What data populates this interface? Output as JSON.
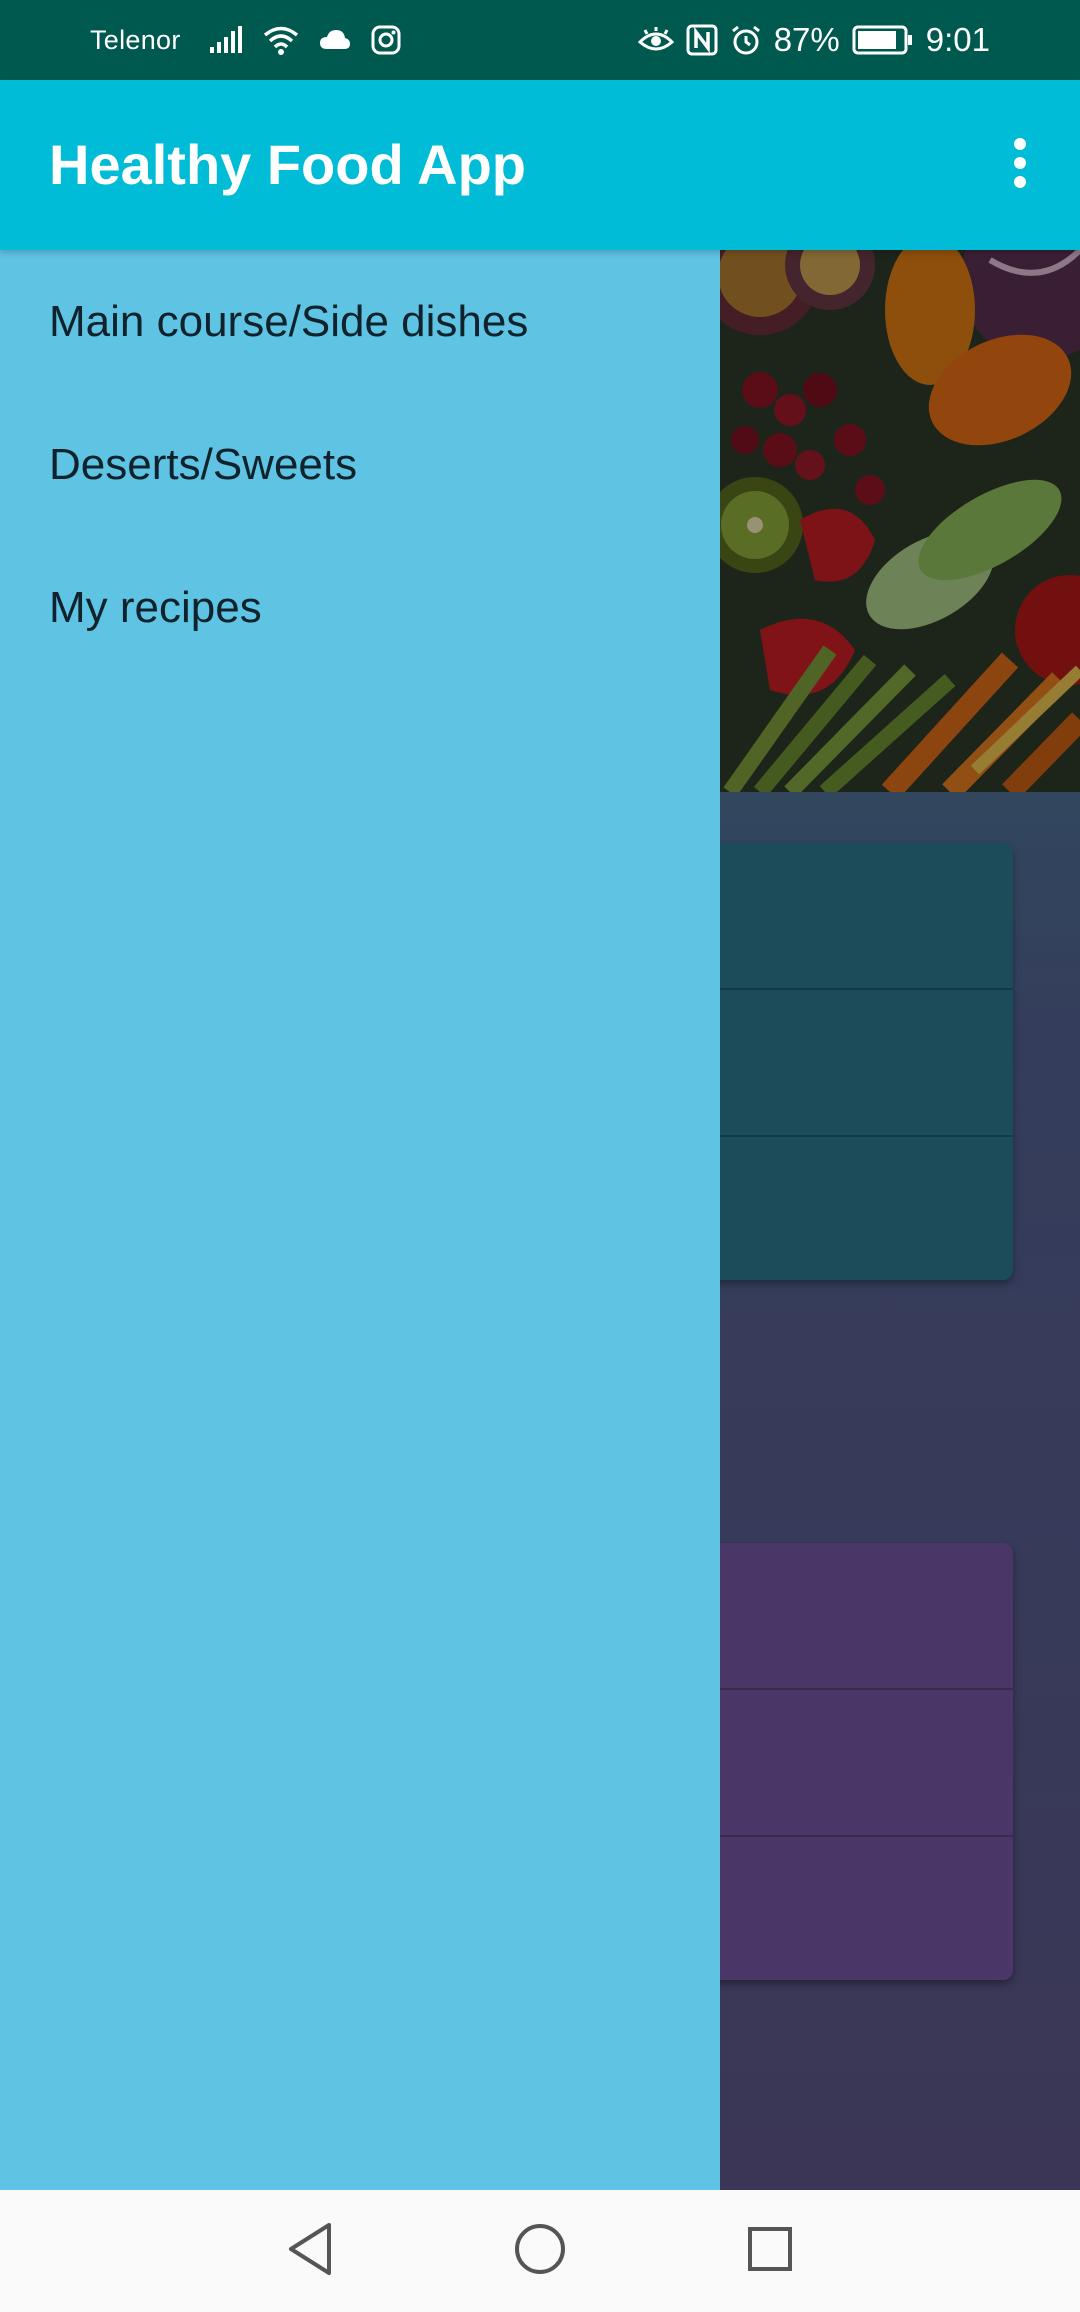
{
  "status_bar": {
    "carrier": "Telenor",
    "battery_percent": "87%",
    "time": "9:01",
    "left_icons": [
      "signal-icon",
      "wifi-icon",
      "cloud-icon",
      "instagram-icon"
    ],
    "right_icons": [
      "eye-comfort-icon",
      "nfc-icon",
      "alarm-icon",
      "battery-icon"
    ],
    "battery_level": 0.87
  },
  "app_bar": {
    "title": "Healthy Food App",
    "menu_icon": "more-vert-icon"
  },
  "drawer": {
    "items": [
      {
        "label": "Main course/Side dishes"
      },
      {
        "label": "Deserts/Sweets"
      },
      {
        "label": "My recipes"
      }
    ]
  },
  "nav_bar": {
    "buttons": [
      "back-icon",
      "home-icon",
      "recents-icon"
    ]
  },
  "colors": {
    "status_bar": "#00594e",
    "app_bar": "#00bcd6",
    "drawer": "#5fc3e3",
    "card_teal": "#1c4b5a",
    "card_purple": "#4a3767"
  }
}
